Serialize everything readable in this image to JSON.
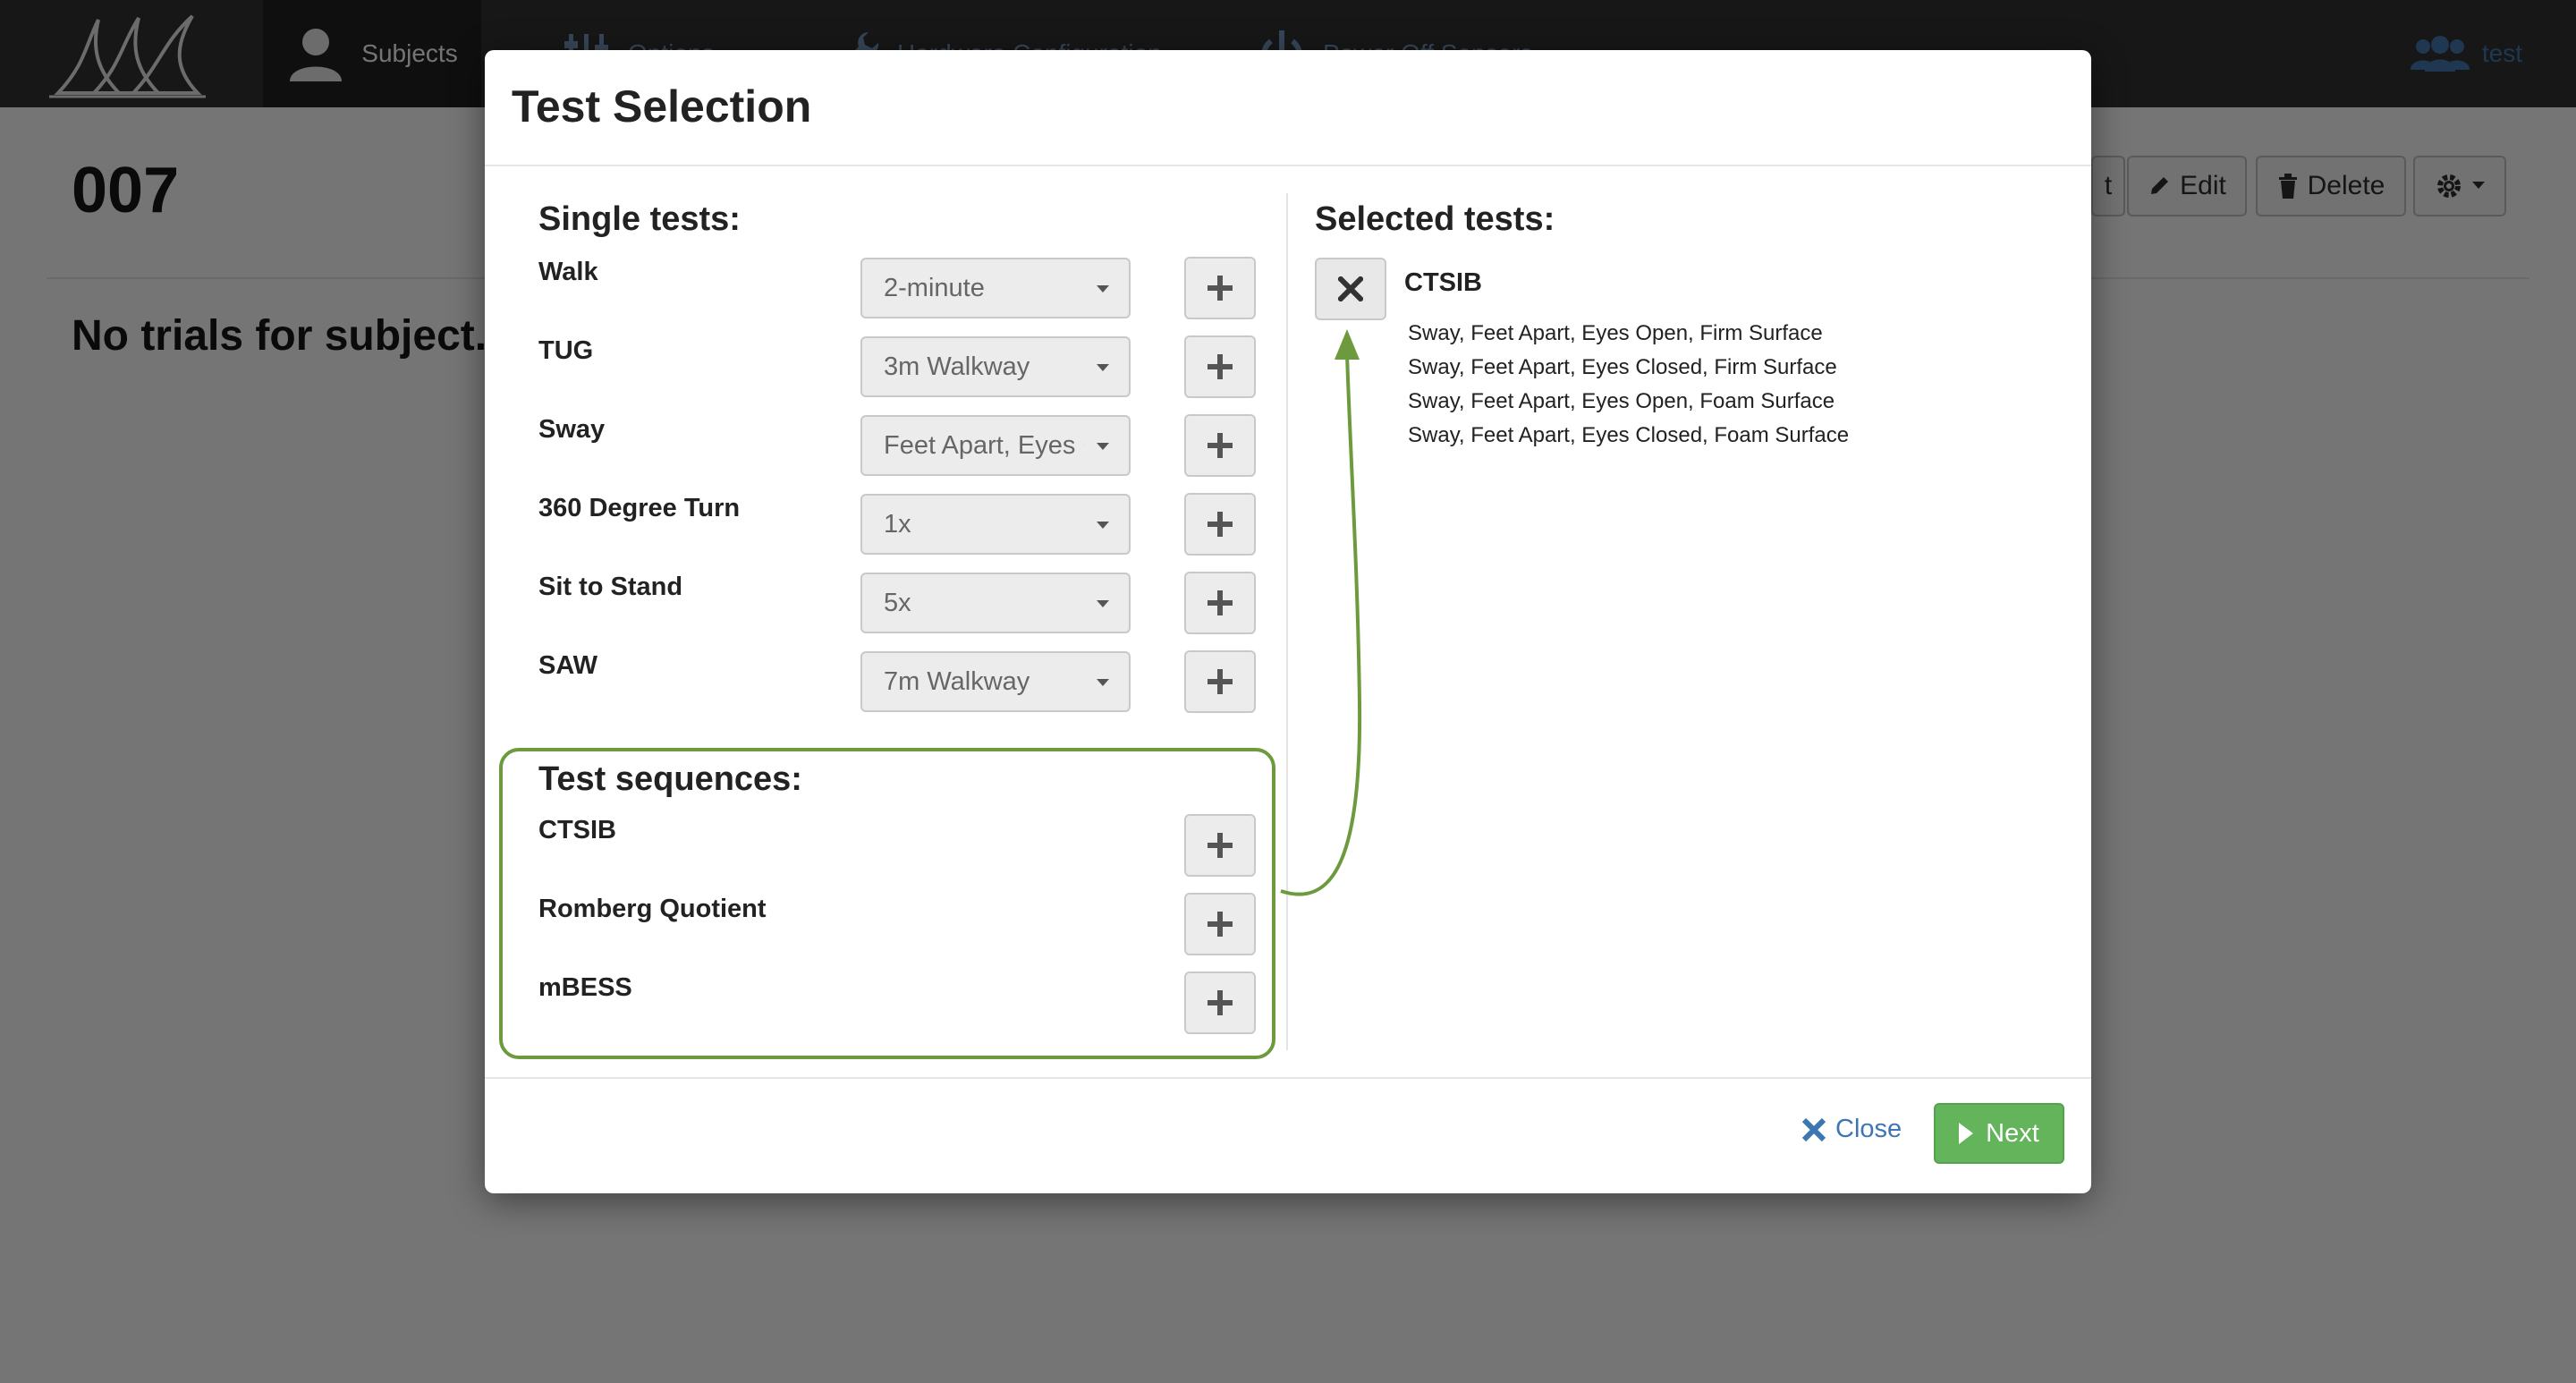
{
  "nav": {
    "subjects_label": "Subjects",
    "options_label": "Options",
    "hardware_label": "Hardware Configuration",
    "power_label": "Power Off Sensors",
    "user_label": "test"
  },
  "page": {
    "title": "007",
    "empty_message": "No trials for subject.",
    "partial_button_label": "t",
    "edit_label": "Edit",
    "delete_label": "Delete"
  },
  "modal": {
    "title": "Test Selection",
    "single_heading": "Single tests:",
    "single_tests": [
      {
        "label": "Walk",
        "selected": "2-minute"
      },
      {
        "label": "TUG",
        "selected": "3m Walkway"
      },
      {
        "label": "Sway",
        "selected": "Feet Apart, Eyes Open"
      },
      {
        "label": "360 Degree Turn",
        "selected": "1x"
      },
      {
        "label": "Sit to Stand",
        "selected": "5x"
      },
      {
        "label": "SAW",
        "selected": "7m Walkway"
      }
    ],
    "sequences_heading": "Test sequences:",
    "sequences": [
      {
        "label": "CTSIB"
      },
      {
        "label": "Romberg Quotient"
      },
      {
        "label": "mBESS"
      }
    ],
    "selected_heading": "Selected tests:",
    "selected": {
      "name": "CTSIB",
      "items": [
        "Sway, Feet Apart, Eyes Open, Firm Surface",
        "Sway, Feet Apart, Eyes Closed, Firm Surface",
        "Sway, Feet Apart, Eyes Open, Foam Surface",
        "Sway, Feet Apart, Eyes Closed, Foam Surface"
      ]
    },
    "close_label": "Close",
    "next_label": "Next"
  },
  "colors": {
    "highlight_green": "#6e9a3e",
    "next_green": "#64b45c",
    "link_blue": "#3d77b3"
  }
}
